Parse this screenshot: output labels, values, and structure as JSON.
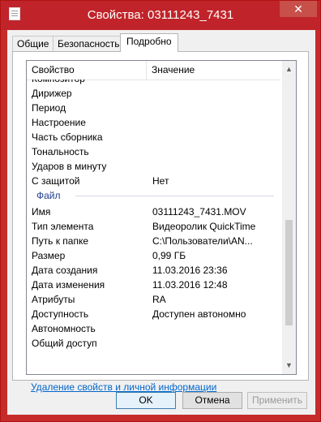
{
  "window": {
    "title": "Свойства: 03111243_7431",
    "close_glyph": "✕"
  },
  "tabs": [
    {
      "label": "Общие"
    },
    {
      "label": "Безопасность"
    },
    {
      "label": "Подробно",
      "active": true
    }
  ],
  "columns": {
    "property": "Свойство",
    "value": "Значение"
  },
  "partial_top_row": "Композитор",
  "rows_top": [
    {
      "k": "Дирижер",
      "v": ""
    },
    {
      "k": "Период",
      "v": ""
    },
    {
      "k": "Настроение",
      "v": ""
    },
    {
      "k": "Часть сборника",
      "v": ""
    },
    {
      "k": "Тональность",
      "v": ""
    },
    {
      "k": "Ударов в минуту",
      "v": ""
    },
    {
      "k": "С защитой",
      "v": "Нет"
    }
  ],
  "group_label": "Файл",
  "rows_file": [
    {
      "k": "Имя",
      "v": "03111243_7431.MOV"
    },
    {
      "k": "Тип элемента",
      "v": "Видеоролик QuickTime"
    },
    {
      "k": "Путь к папке",
      "v": "C:\\Пользователи\\AN..."
    },
    {
      "k": "Размер",
      "v": "0,99 ГБ"
    },
    {
      "k": "Дата создания",
      "v": "11.03.2016 23:36"
    },
    {
      "k": "Дата изменения",
      "v": "11.03.2016 12:48"
    },
    {
      "k": "Атрибуты",
      "v": "RA"
    },
    {
      "k": "Доступность",
      "v": "Доступен автономно"
    },
    {
      "k": "Автономность",
      "v": ""
    },
    {
      "k": "Общий доступ",
      "v": ""
    }
  ],
  "link": "Удаление свойств и личной информации",
  "buttons": {
    "ok": "OK",
    "cancel": "Отмена",
    "apply": "Применить"
  }
}
